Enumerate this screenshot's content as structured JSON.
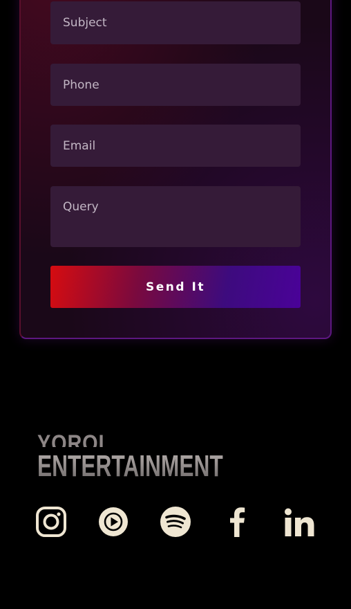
{
  "contact_form": {
    "subject_placeholder": "Subject",
    "phone_placeholder": "Phone",
    "email_placeholder": "Email",
    "query_placeholder": "Query",
    "submit_label": "Send It"
  },
  "footer": {
    "logo_top": "YOROI",
    "logo_main": "ENTERTAINMENT",
    "social_icons": [
      "instagram-icon",
      "youtube-music-icon",
      "spotify-icon",
      "facebook-icon",
      "linkedin-icon"
    ]
  },
  "colors": {
    "background": "#000000",
    "field_bg": "#351b38",
    "button_gradient_start": "#d60c10",
    "button_gradient_end": "#4a0298",
    "icon_color": "#efe6d2"
  }
}
